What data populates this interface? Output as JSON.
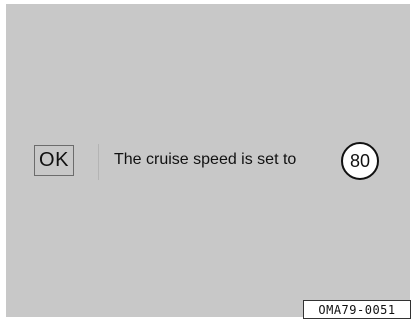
{
  "display": {
    "ok_label": "OK",
    "message": "The cruise speed is set to",
    "speed_value": "80"
  },
  "figure_code": "OMA79-0051",
  "colors": {
    "screen_background": "#c8c8c8",
    "text": "#111111",
    "badge_background": "#ffffff"
  }
}
